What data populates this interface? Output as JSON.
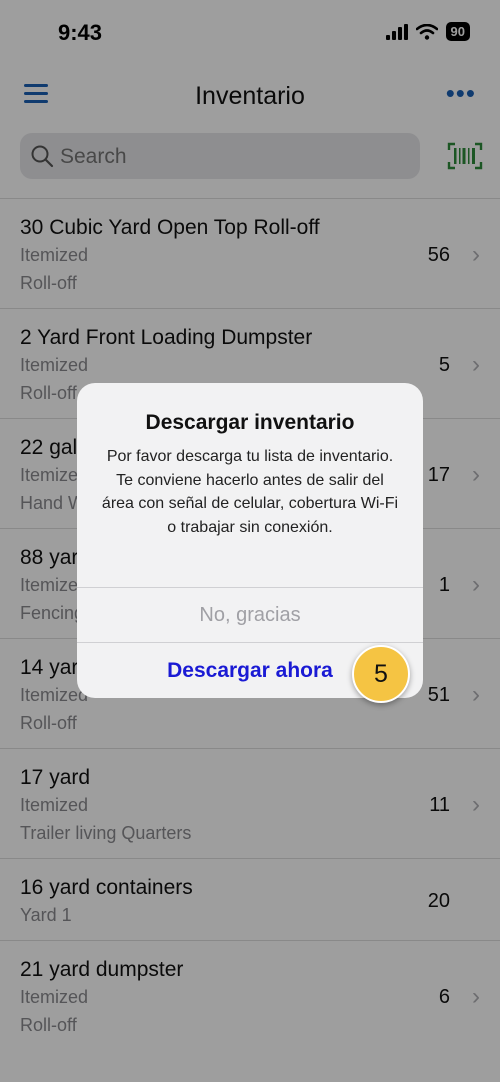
{
  "status": {
    "time": "9:43",
    "battery": "90"
  },
  "nav": {
    "title": "Inventario",
    "more": "•••"
  },
  "search": {
    "placeholder": "Search"
  },
  "items": [
    {
      "title": "30 Cubic Yard Open Top Roll-off",
      "sub1": "Itemized",
      "sub2": "Roll-off",
      "count": "56"
    },
    {
      "title": "2 Yard Front Loading Dumpster",
      "sub1": "Itemized",
      "sub2": "Roll-off",
      "count": "5"
    },
    {
      "title": "22 gal",
      "sub1": "Itemized",
      "sub2": "Hand W",
      "count": "17"
    },
    {
      "title": "88 yard",
      "sub1": "Itemized",
      "sub2": "Fencing",
      "count": "1"
    },
    {
      "title": "14 yard",
      "sub1": "Itemized",
      "sub2": "Roll-off",
      "count": "51"
    },
    {
      "title": "17 yard",
      "sub1": "Itemized",
      "sub2": "Trailer living Quarters",
      "count": "11"
    },
    {
      "title": "16 yard containers",
      "sub1": "Yard 1",
      "count": "20"
    },
    {
      "title": "21 yard dumpster",
      "sub1": "Itemized",
      "sub2": "Roll-off",
      "count": "6"
    }
  ],
  "dialog": {
    "title": "Descargar inventario",
    "message": "Por favor descarga tu lista de inventario. Te conviene hacerlo antes de salir del área con señal de celular, cobertura Wi-Fi o trabajar sin conexión.",
    "no_label": "No, gracias",
    "yes_label": "Descargar ahora"
  },
  "step_badge": "5",
  "colors": {
    "accent": "#1a5fb4",
    "barcode": "#2e8b3a",
    "badge": "#f5c443",
    "primary_button": "#1a1ad4"
  }
}
